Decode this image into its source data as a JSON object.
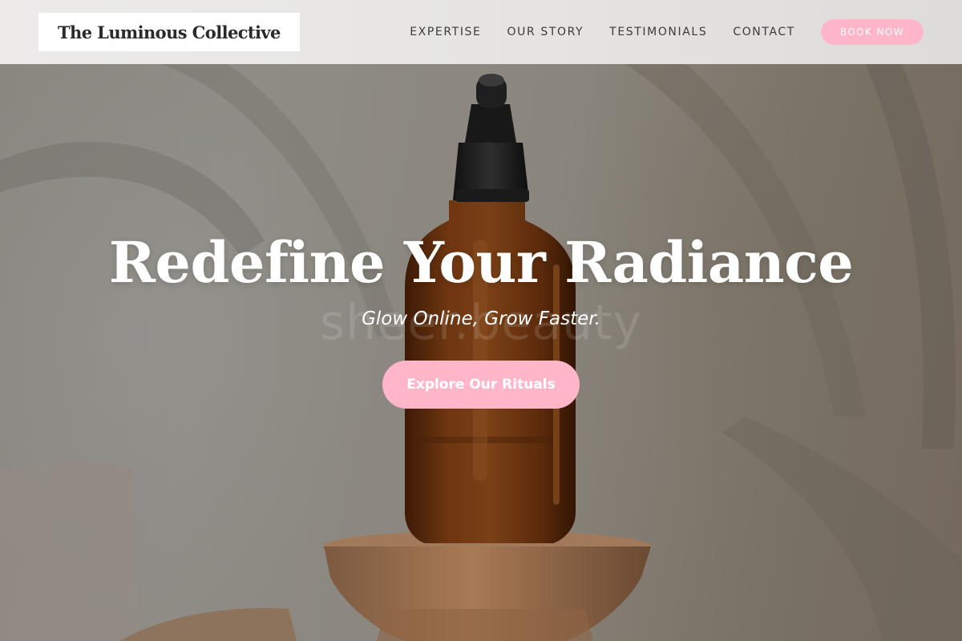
{
  "brand": {
    "name": "The Luminous Collective"
  },
  "nav": {
    "items": [
      {
        "label": "EXPERTISE"
      },
      {
        "label": "OUR STORY"
      },
      {
        "label": "TESTIMONIALS"
      },
      {
        "label": "CONTACT"
      }
    ],
    "cta_label": "BOOK NOW"
  },
  "hero": {
    "title": "Redefine Your Radiance",
    "subtitle": "Glow Online, Grow Faster.",
    "watermark": "sheer.beauty",
    "cta_label": "Explore Our Rituals",
    "image_subject": "amber-dropper-bottle-on-wooden-pedestal"
  },
  "colors": {
    "accent_pink": "#ffb6c8",
    "header_bg": "#e9e8e6",
    "text_dark": "#2a2a2a",
    "bottle_amber": "#6b3310"
  }
}
